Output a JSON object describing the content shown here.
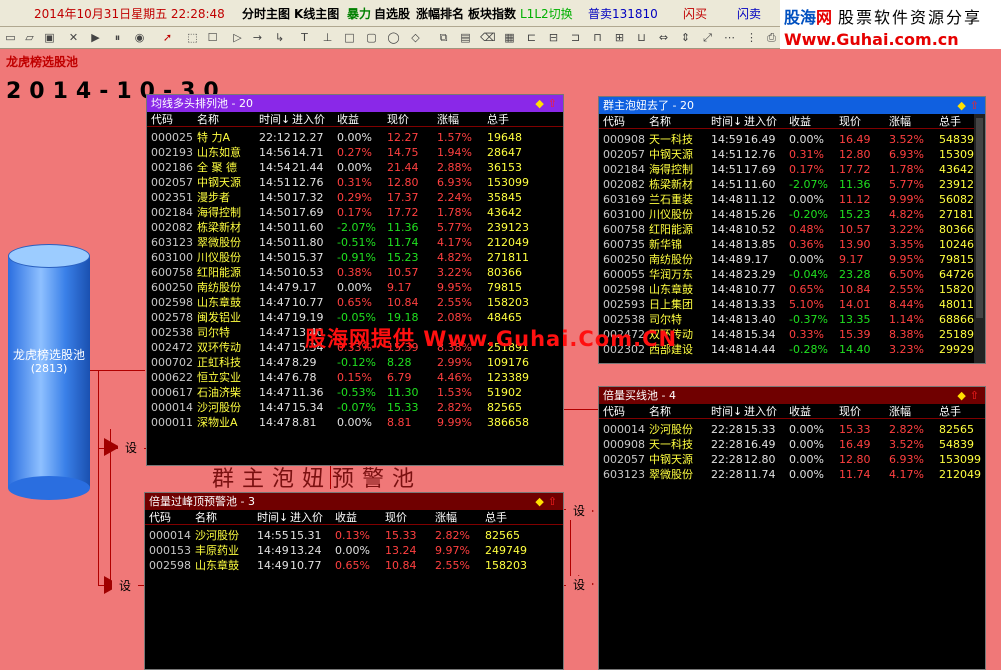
{
  "topbar": {
    "datetime": "2014年10月31日星期五 22:28:48",
    "fenshi": "分时主图",
    "kline": "K线主图",
    "baoli": "暴力",
    "zixuan": "自选股",
    "zhangfu": "涨幅排名",
    "bankuai": "板块指数",
    "l1l2": "L1L2切换",
    "stock": "普卖131810",
    "shanmai": "闪买",
    "shanmai2": "闪卖"
  },
  "brand": {
    "name_blue": "股海",
    "name_red": "网",
    "slogan": "股票软件资源分享",
    "url": "Www.Guhai.com.cn"
  },
  "page": {
    "title": "龙虎榜选股池",
    "date": "2014-10-30"
  },
  "source": {
    "label": "龙虎榜选股池",
    "count": "(2813)"
  },
  "connector": {
    "label": "设"
  },
  "watermark": "股海网提供 Www.Guhai.Com.CN",
  "warning_text": "群主泡妞预警池",
  "columns": [
    "代码",
    "名称",
    "时间↓",
    "进入价",
    "收益",
    "现价",
    "涨幅",
    "总手"
  ],
  "colors": {
    "header_purple": "#8a28e8",
    "header_blue": "#1060e0",
    "header_dark": "#700000",
    "up": "#ff4040",
    "down": "#20e020"
  },
  "panels": [
    {
      "title": "均线多头排列池 - 20",
      "rows": [
        [
          "000025",
          "特 力A",
          "22:12",
          "12.27",
          "0.00%",
          "12.27",
          "1.57%",
          "19648"
        ],
        [
          "002193",
          "山东如意",
          "14:56",
          "14.71",
          "0.27%",
          "14.75",
          "1.94%",
          "28647"
        ],
        [
          "002186",
          "全 聚 德",
          "14:54",
          "21.44",
          "0.00%",
          "21.44",
          "2.88%",
          "36153"
        ],
        [
          "002057",
          "中钢天源",
          "14:51",
          "12.76",
          "0.31%",
          "12.80",
          "6.93%",
          "153099"
        ],
        [
          "002351",
          "漫步者",
          "14:50",
          "17.32",
          "0.29%",
          "17.37",
          "2.24%",
          "35845"
        ],
        [
          "002184",
          "海得控制",
          "14:50",
          "17.69",
          "0.17%",
          "17.72",
          "1.78%",
          "43642"
        ],
        [
          "002082",
          "栋梁新材",
          "14:50",
          "11.60",
          "-2.07%",
          "11.36",
          "5.77%",
          "239123"
        ],
        [
          "603123",
          "翠微股份",
          "14:50",
          "11.80",
          "-0.51%",
          "11.74",
          "4.17%",
          "212049"
        ],
        [
          "603100",
          "川仪股份",
          "14:50",
          "15.37",
          "-0.91%",
          "15.23",
          "4.82%",
          "271811"
        ],
        [
          "600758",
          "红阳能源",
          "14:50",
          "10.53",
          "0.38%",
          "10.57",
          "3.22%",
          "80366"
        ],
        [
          "600250",
          "南纺股份",
          "14:47",
          "9.17",
          "0.00%",
          "9.17",
          "9.95%",
          "79815"
        ],
        [
          "002598",
          "山东章鼓",
          "14:47",
          "10.77",
          "0.65%",
          "10.84",
          "2.55%",
          "158203"
        ],
        [
          "002578",
          "闽发铝业",
          "14:47",
          "19.19",
          "-0.05%",
          "19.18",
          "2.08%",
          "48465"
        ],
        [
          "002538",
          "司尔特",
          "14:47",
          "13.40",
          "",
          "",
          "",
          ""
        ],
        [
          "002472",
          "双环传动",
          "14:47",
          "15.34",
          "0.33%",
          "15.39",
          "8.38%",
          "251891"
        ],
        [
          "000702",
          "正虹科技",
          "14:47",
          "8.29",
          "-0.12%",
          "8.28",
          "2.99%",
          "109176"
        ],
        [
          "000622",
          "恒立实业",
          "14:47",
          "6.78",
          "0.15%",
          "6.79",
          "4.46%",
          "123389"
        ],
        [
          "000617",
          "石油济柴",
          "14:47",
          "11.36",
          "-0.53%",
          "11.30",
          "1.53%",
          "51902"
        ],
        [
          "000014",
          "沙河股份",
          "14:47",
          "15.34",
          "-0.07%",
          "15.33",
          "2.82%",
          "82565"
        ],
        [
          "000011",
          "深物业A",
          "14:47",
          "8.81",
          "0.00%",
          "8.81",
          "9.99%",
          "386658"
        ]
      ]
    },
    {
      "title": "群主泡妞去了 - 20",
      "rows": [
        [
          "000908",
          "天一科技",
          "14:59",
          "16.49",
          "0.00%",
          "16.49",
          "3.52%",
          "54839"
        ],
        [
          "002057",
          "中钢天源",
          "14:51",
          "12.76",
          "0.31%",
          "12.80",
          "6.93%",
          "15309"
        ],
        [
          "002184",
          "海得控制",
          "14:51",
          "17.69",
          "0.17%",
          "17.72",
          "1.78%",
          "43642"
        ],
        [
          "002082",
          "栋梁新材",
          "14:51",
          "11.60",
          "-2.07%",
          "11.36",
          "5.77%",
          "23912"
        ],
        [
          "603169",
          "兰石重装",
          "14:48",
          "11.12",
          "0.00%",
          "11.12",
          "9.99%",
          "56082"
        ],
        [
          "603100",
          "川仪股份",
          "14:48",
          "15.26",
          "-0.20%",
          "15.23",
          "4.82%",
          "27181"
        ],
        [
          "600758",
          "红阳能源",
          "14:48",
          "10.52",
          "0.48%",
          "10.57",
          "3.22%",
          "80366"
        ],
        [
          "600735",
          "新华锦",
          "14:48",
          "13.85",
          "0.36%",
          "13.90",
          "3.35%",
          "10246"
        ],
        [
          "600250",
          "南纺股份",
          "14:48",
          "9.17",
          "0.00%",
          "9.17",
          "9.95%",
          "79815"
        ],
        [
          "600055",
          "华润万东",
          "14:48",
          "23.29",
          "-0.04%",
          "23.28",
          "6.50%",
          "64726"
        ],
        [
          "002598",
          "山东章鼓",
          "14:48",
          "10.77",
          "0.65%",
          "10.84",
          "2.55%",
          "15820"
        ],
        [
          "002593",
          "日上集团",
          "14:48",
          "13.33",
          "5.10%",
          "14.01",
          "8.44%",
          "48011"
        ],
        [
          "002538",
          "司尔特",
          "14:48",
          "13.40",
          "-0.37%",
          "13.35",
          "1.14%",
          "68866"
        ],
        [
          "002472",
          "双环传动",
          "14:48",
          "15.34",
          "0.33%",
          "15.39",
          "8.38%",
          "25189"
        ],
        [
          "002302",
          "西部建设",
          "14:48",
          "14.44",
          "-0.28%",
          "14.40",
          "3.23%",
          "29929"
        ]
      ]
    },
    {
      "title": "倍量买线池 - 4",
      "rows": [
        [
          "000014",
          "沙河股份",
          "22:28",
          "15.33",
          "0.00%",
          "15.33",
          "2.82%",
          "82565"
        ],
        [
          "000908",
          "天一科技",
          "22:28",
          "16.49",
          "0.00%",
          "16.49",
          "3.52%",
          "54839"
        ],
        [
          "002057",
          "中钢天源",
          "22:28",
          "12.80",
          "0.00%",
          "12.80",
          "6.93%",
          "153099"
        ],
        [
          "603123",
          "翠微股份",
          "22:28",
          "11.74",
          "0.00%",
          "11.74",
          "4.17%",
          "212049"
        ]
      ]
    },
    {
      "title": "倍量过峰顶预警池 - 3",
      "rows": [
        [
          "000014",
          "沙河股份",
          "14:55",
          "15.31",
          "0.13%",
          "15.33",
          "2.82%",
          "82565"
        ],
        [
          "000153",
          "丰原药业",
          "14:49",
          "13.24",
          "0.00%",
          "13.24",
          "9.97%",
          "249749"
        ],
        [
          "002598",
          "山东章鼓",
          "14:49",
          "10.77",
          "0.65%",
          "10.84",
          "2.55%",
          "158203"
        ]
      ]
    }
  ]
}
